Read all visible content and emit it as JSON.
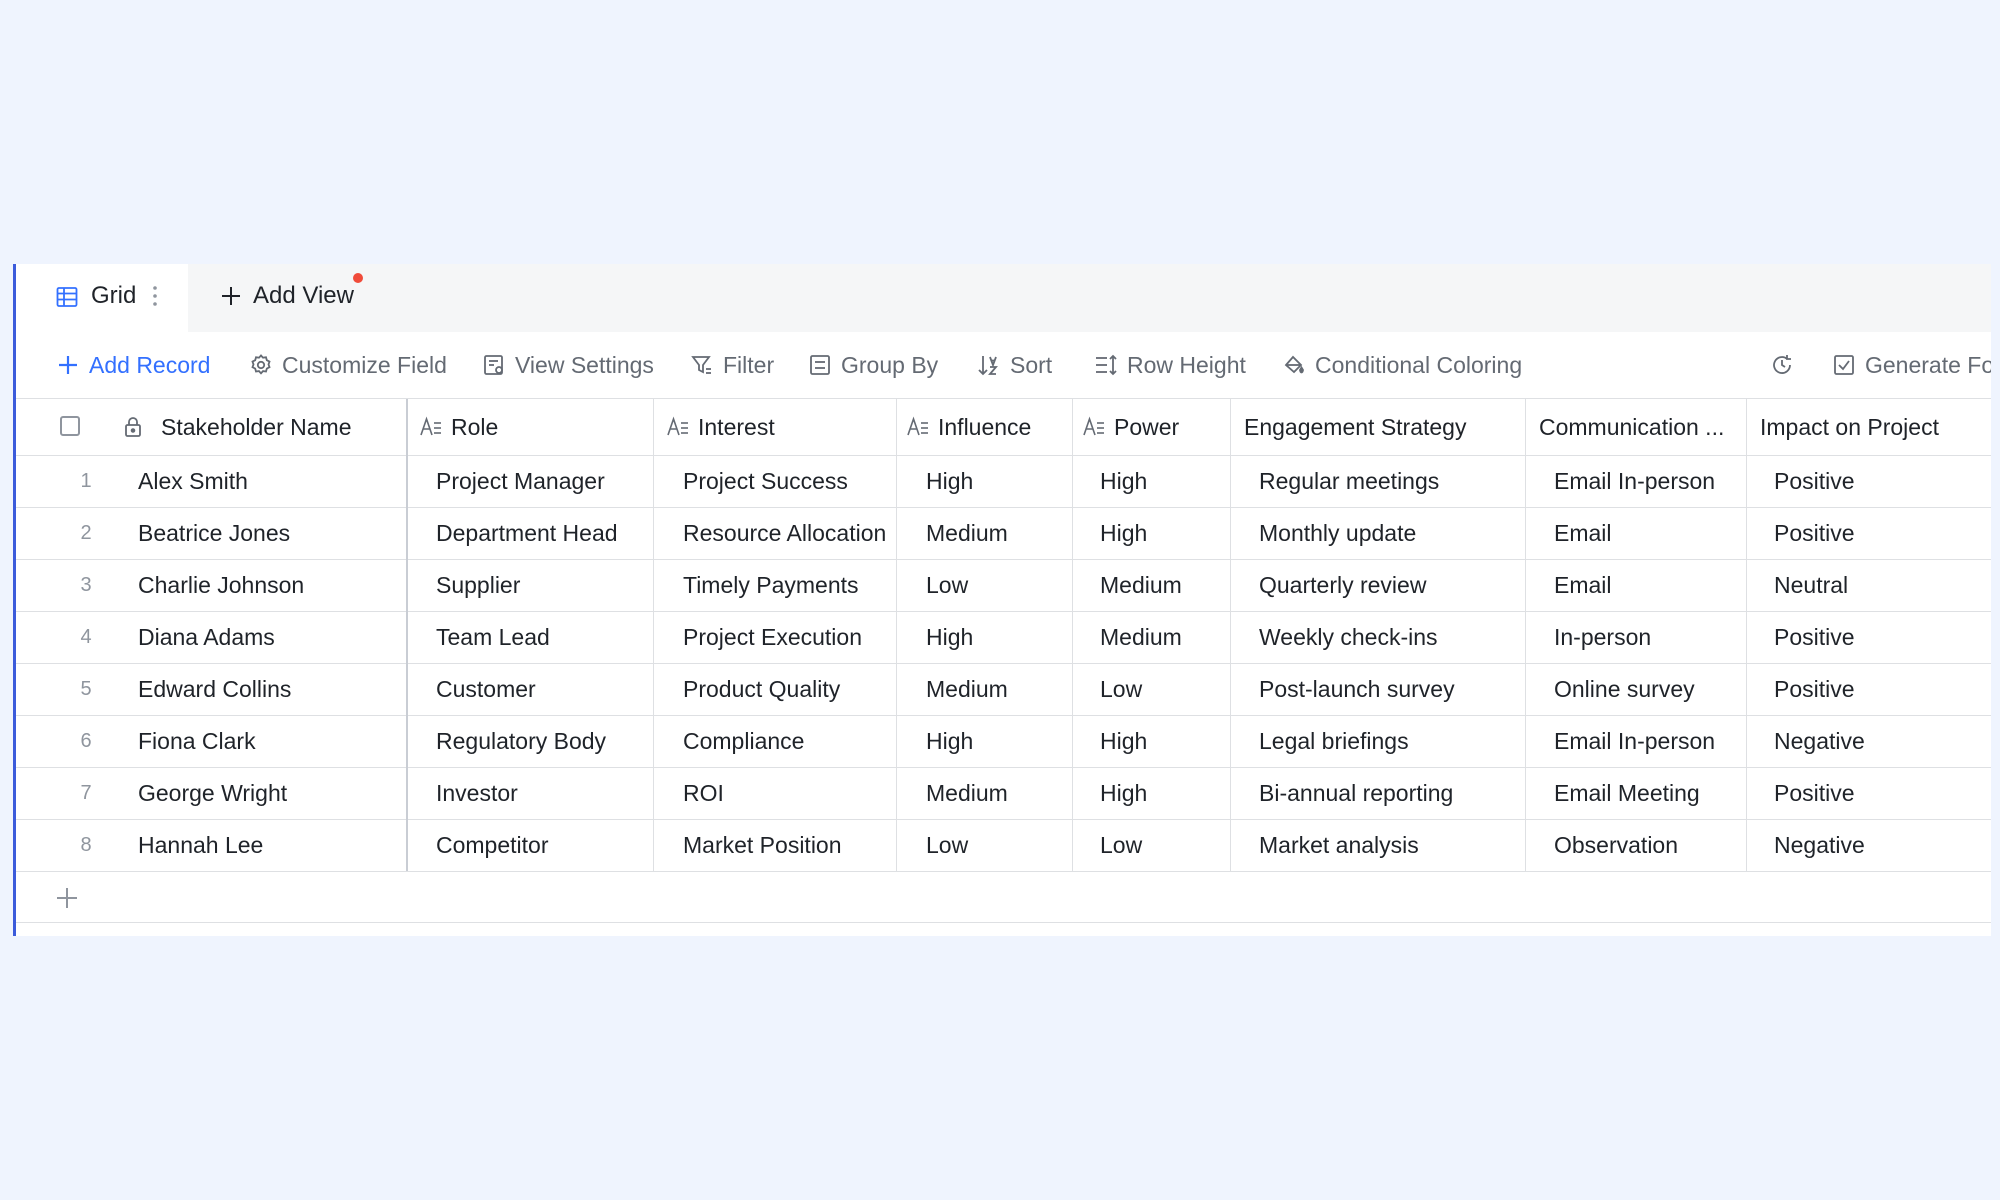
{
  "tabs": {
    "grid_label": "Grid",
    "add_view_label": "Add View"
  },
  "toolbar": {
    "add_record": "Add Record",
    "customize_field": "Customize Field",
    "view_settings": "View Settings",
    "filter": "Filter",
    "group_by": "Group By",
    "sort": "Sort",
    "row_height": "Row Height",
    "conditional_coloring": "Conditional Coloring",
    "generate_form": "Generate For"
  },
  "columns": [
    "Stakeholder Name",
    "Role",
    "Interest",
    "Influence",
    "Power",
    "Engagement Strategy",
    "Communication ...",
    "Impact on Project"
  ],
  "rows": [
    {
      "num": "1",
      "cells": [
        "Alex Smith",
        "Project Manager",
        "Project Success",
        "High",
        "High",
        "Regular meetings",
        "Email In-person",
        "Positive"
      ]
    },
    {
      "num": "2",
      "cells": [
        "Beatrice Jones",
        "Department Head",
        "Resource Allocation",
        "Medium",
        "High",
        "Monthly update",
        "Email",
        "Positive"
      ]
    },
    {
      "num": "3",
      "cells": [
        "Charlie Johnson",
        "Supplier",
        "Timely Payments",
        "Low",
        "Medium",
        "Quarterly review",
        "Email",
        "Neutral"
      ]
    },
    {
      "num": "4",
      "cells": [
        "Diana Adams",
        "Team Lead",
        "Project Execution",
        "High",
        "Medium",
        "Weekly check-ins",
        "In-person",
        "Positive"
      ]
    },
    {
      "num": "5",
      "cells": [
        "Edward Collins",
        "Customer",
        "Product Quality",
        "Medium",
        "Low",
        "Post-launch survey",
        "Online survey",
        "Positive"
      ]
    },
    {
      "num": "6",
      "cells": [
        "Fiona Clark",
        "Regulatory Body",
        "Compliance",
        "High",
        "High",
        "Legal briefings",
        "Email In-person",
        "Negative"
      ]
    },
    {
      "num": "7",
      "cells": [
        "George Wright",
        "Investor",
        "ROI",
        "Medium",
        "High",
        "Bi-annual reporting",
        "Email Meeting",
        "Positive"
      ]
    },
    {
      "num": "8",
      "cells": [
        "Hannah Lee",
        "Competitor",
        "Market Position",
        "Low",
        "Low",
        "Market analysis",
        "Observation",
        "Negative"
      ]
    }
  ],
  "colors": {
    "accent": "#3370ff",
    "panel_border": "#3b5bdb",
    "background": "#eff4fe",
    "notification_dot": "#f04b3a"
  }
}
